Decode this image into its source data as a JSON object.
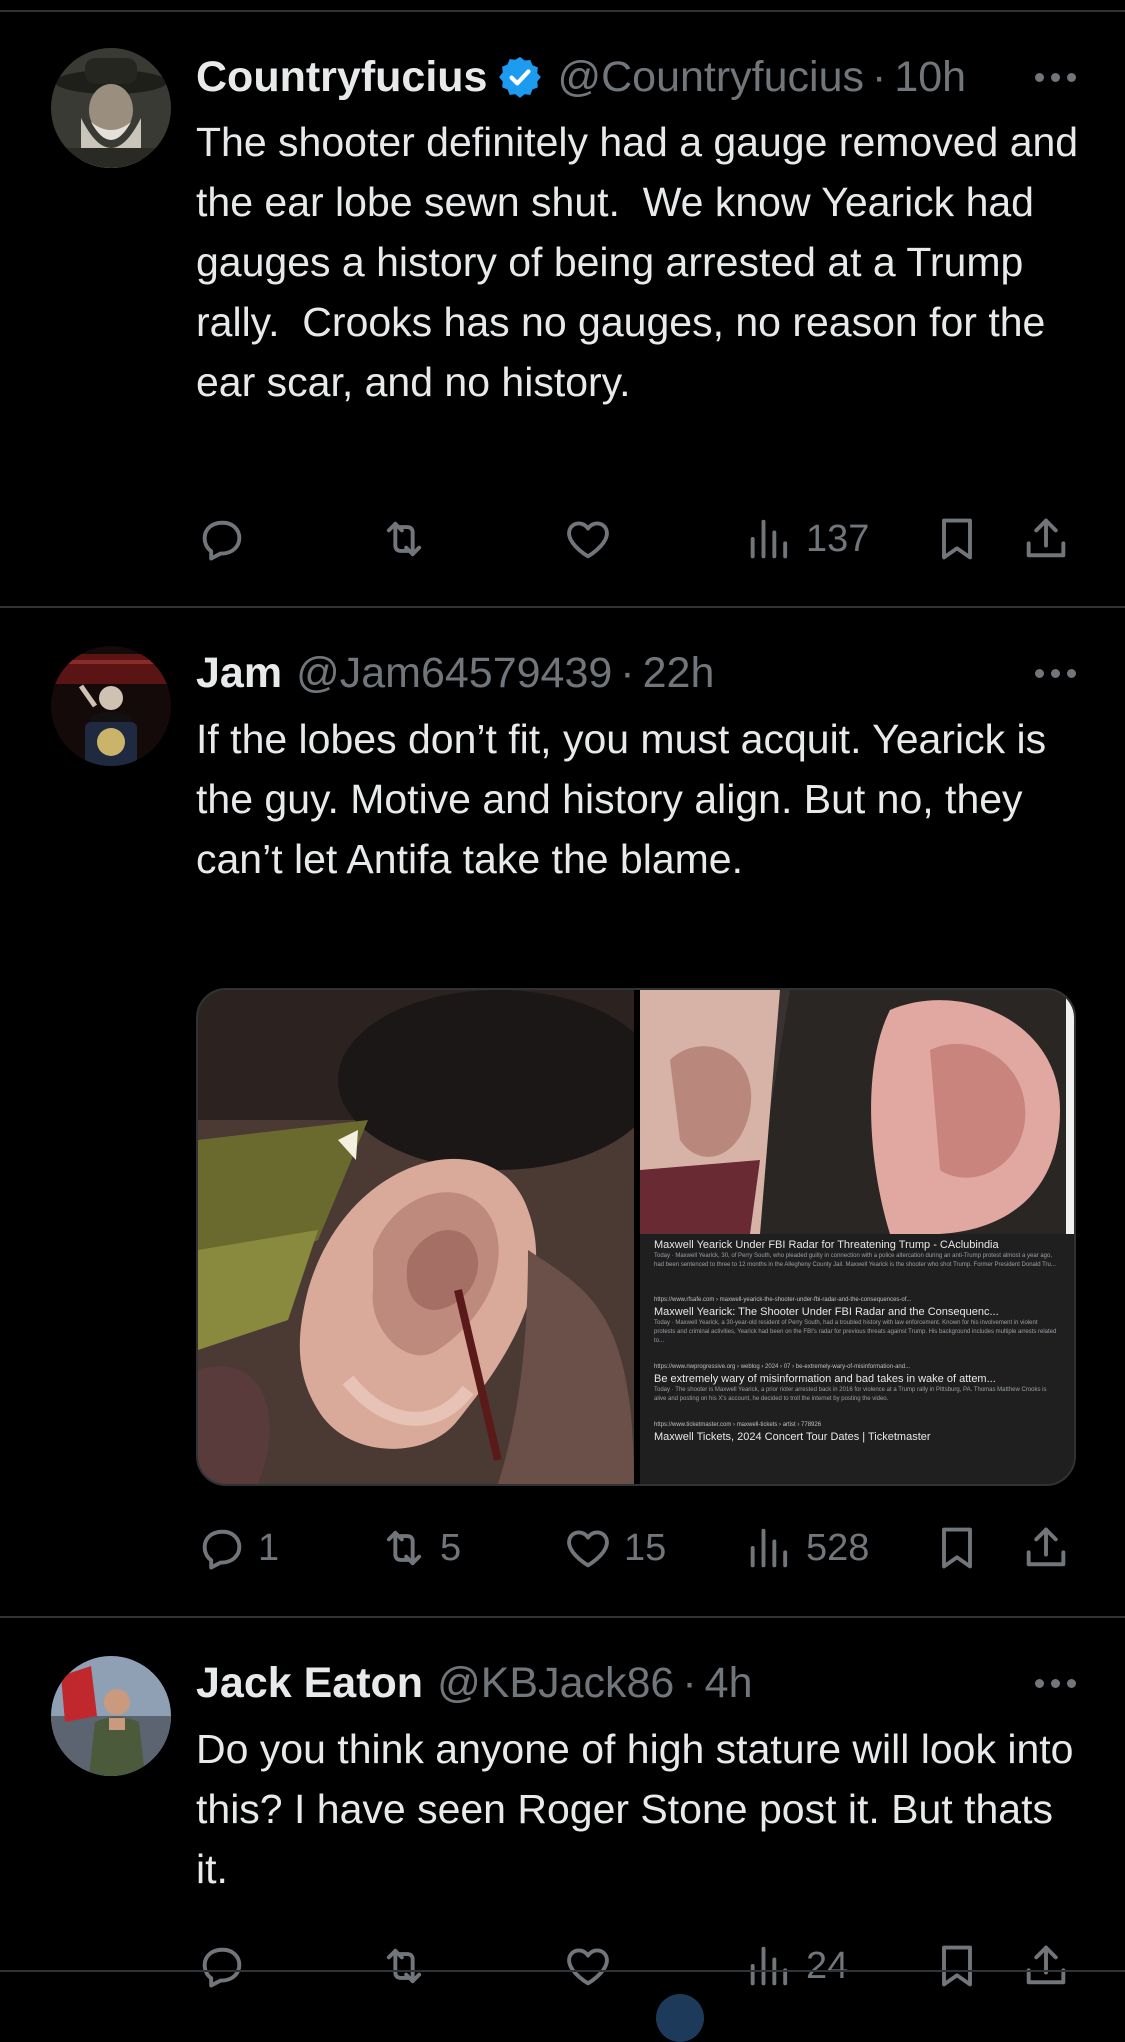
{
  "tweets": [
    {
      "name": "Countryfucius",
      "handle": "@Countryfucius",
      "time": "10h",
      "text": "The shooter definitely had a gauge removed and the ear lobe sewn shut.  We know Yearick had gauges a history of being arrested at a Trump rally.  Crooks has no gauges, no reason for the ear scar, and no history.",
      "reply_count": "",
      "retweet_count": "",
      "like_count": "",
      "view_count": "137",
      "verified": true
    },
    {
      "name": "Jam",
      "handle": "@Jam64579439",
      "time": "22h",
      "text": "If the lobes don’t fit, you must acquit. Yearick is the guy. Motive and history align. But no, they can’t let Antifa take the blame.",
      "reply_count": "1",
      "retweet_count": "5",
      "like_count": "15",
      "view_count": "528",
      "verified": false
    },
    {
      "name": "Jack Eaton",
      "handle": "@KBJack86",
      "time": "4h",
      "text": "Do you think anyone of high stature will look into this? I have seen Roger Stone post it. But thats it.",
      "reply_count": "",
      "retweet_count": "",
      "like_count": "",
      "view_count": "24",
      "verified": false
    }
  ],
  "separator": "·",
  "search_results": [
    {
      "title": "Maxwell Yearick Under FBI Radar for Threatening Trump - CAclubindia",
      "url": "",
      "snippet": "Today · Maxwell Yearick, 30, of Perry South, who pleaded guilty in connection with a police altercation during an anti-Trump protest almost a year ago, had been sentenced to three to 12 months in the Allegheny County Jail. Maxwell Yearick is the shooter who shot Trump. Former President Donald Tru..."
    },
    {
      "title": "Maxwell Yearick: The Shooter Under FBI Radar and the Consequenc...",
      "url": "https://www.rfsafe.com › maxwell-yearick-the-shooter-under-fbi-radar-and-the-consequences-of...",
      "snippet": "Today · Maxwell Yearick, a 30-year-old resident of Perry South, had a troubled history with law enforcement. Known for his involvement in violent protests and criminal activities, Yearick had been on the FBI's radar for previous threats against Trump. His background includes multiple arrests related to..."
    },
    {
      "title": "Be extremely wary of misinformation and bad takes in wake of attem...",
      "url": "https://www.nwprogressive.org › weblog › 2024 › 07 › be-extremely-wary-of-misinformation-and...",
      "snippet": "Today · The shooter is Maxwell Yearick, a prior rioter arrested back in 2016 for violence at a Trump rally in Pittsburg, PA. Thomas Matthew Crooks is alive and posting on his X's account, he decided to troll the internet by posting the video."
    },
    {
      "title": "Maxwell Tickets, 2024 Concert Tour Dates | Ticketmaster",
      "url": "https://www.ticketmaster.com › maxwell-tickets › artist › 778926",
      "snippet": ""
    }
  ],
  "icons": {
    "reply": "reply-icon",
    "retweet": "retweet-icon",
    "like": "heart-icon",
    "views": "views-icon",
    "bookmark": "bookmark-icon",
    "share": "share-icon",
    "more": "more-icon",
    "verified": "verified-badge-icon"
  },
  "colors": {
    "background": "#000000",
    "text": "#e7e9ea",
    "muted": "#71767b",
    "verified": "#1d9bf0",
    "divider": "#2f3336"
  }
}
